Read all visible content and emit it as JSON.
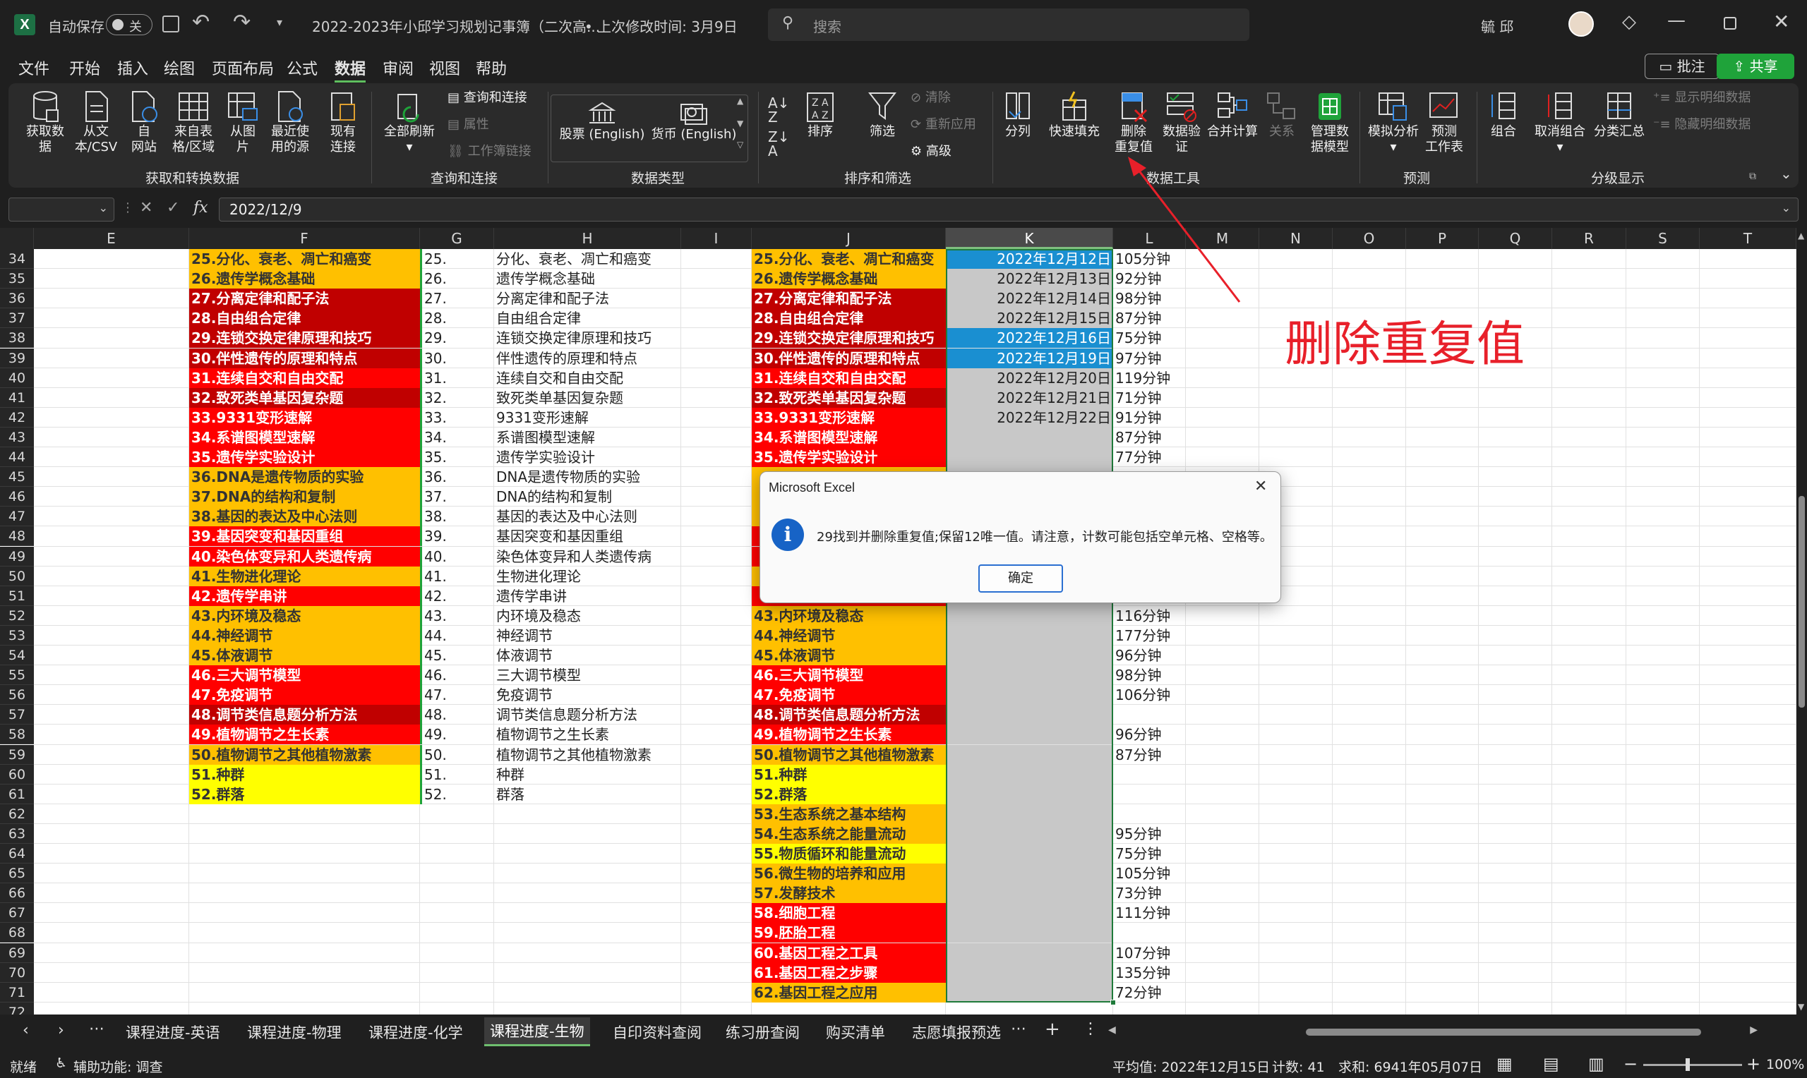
{
  "colors": {
    "red": "#ff0000",
    "darkred": "#c00000",
    "orange": "#ffc000",
    "yellow": "#ffff00",
    "selection": "#c8c8c8",
    "selectedCell": "#1a8fd1",
    "accent": "#1fa33a",
    "annotation": "#e8202a"
  },
  "titlebar": {
    "autosave_label": "自动保存",
    "autosave_state": "关",
    "filename": "2022-2023年小邱学习规划记事簿（二次高...",
    "last_modified": "• 上次修改时间: 3月9日",
    "search_placeholder": "搜索",
    "user": "毓 邱"
  },
  "menu": {
    "items": [
      "文件",
      "开始",
      "插入",
      "绘图",
      "页面布局",
      "公式",
      "数据",
      "审阅",
      "视图",
      "帮助"
    ],
    "comment_button": "批注",
    "share_button": "共享"
  },
  "ribbon": {
    "get_data": "获取数\n据",
    "from_csv": "从文\n本/CSV",
    "from_web": "自\n网站",
    "from_table": "来自表\n格/区域",
    "from_picture": "从图\n片",
    "recent_sources": "最近使\n用的源",
    "existing": "现有\n连接",
    "group_get": "获取和转换数据",
    "refresh_all": "全部刷新",
    "queries": "查询和连接",
    "properties": "属性",
    "workbook_links": "工作簿链接",
    "group_queries": "查询和连接",
    "stocks": "股票 (English)",
    "currency": "货币 (English)",
    "group_datatypes": "数据类型",
    "sort": "排序",
    "filter": "筛选",
    "clear": "清除",
    "reapply": "重新应用",
    "advanced": "高级",
    "group_sort": "排序和筛选",
    "text_to_col": "分列",
    "flash_fill": "快速填充",
    "remove_dup": "删除\n重复值",
    "validation": "数据验\n证",
    "consolidate": "合并计算",
    "relations": "关系",
    "manage_model": "管理数\n据模型",
    "group_tools": "数据工具",
    "whatif": "模拟分析",
    "forecast": "预测\n工作表",
    "group_forecast": "预测",
    "group": "组合",
    "ungroup": "取消组合",
    "subtotal": "分类汇总",
    "show_detail": "显示明细数据",
    "hide_detail": "隐藏明细数据",
    "group_outline": "分级显示"
  },
  "formula": {
    "namebox": "",
    "fx": "fx",
    "value": "2022/12/9"
  },
  "columns": [
    "E",
    "F",
    "G",
    "H",
    "I",
    "J",
    "K",
    "L",
    "M",
    "N",
    "O",
    "P",
    "Q",
    "R",
    "S",
    "T"
  ],
  "rows": [
    {
      "n": "34",
      "F": "25.分化、衰老、凋亡和癌变",
      "Fc": "orange",
      "G": "25.",
      "H": "分化、衰老、凋亡和癌变",
      "J": "25.分化、衰老、凋亡和癌变",
      "Jc": "orange",
      "K": "2022年12月12日",
      "Ksel": true,
      "L": "105分钟"
    },
    {
      "n": "35",
      "F": "26.遗传学概念基础",
      "Fc": "orange",
      "G": "26.",
      "H": "遗传学概念基础",
      "J": "26.遗传学概念基础",
      "Jc": "orange",
      "K": "2022年12月13日",
      "L": "92分钟"
    },
    {
      "n": "36",
      "F": "27.分离定律和配子法",
      "Fc": "darkred",
      "G": "27.",
      "H": "分离定律和配子法",
      "J": "27.分离定律和配子法",
      "Jc": "darkred",
      "K": "2022年12月14日",
      "L": "98分钟"
    },
    {
      "n": "37",
      "F": "28.自由组合定律",
      "Fc": "darkred",
      "G": "28.",
      "H": "自由组合定律",
      "J": "28.自由组合定律",
      "Jc": "darkred",
      "K": "2022年12月15日",
      "L": "87分钟"
    },
    {
      "n": "38",
      "F": "29.连锁交换定律原理和技巧",
      "Fc": "darkred",
      "G": "29.",
      "H": "连锁交换定律原理和技巧",
      "J": "29.连锁交换定律原理和技巧",
      "Jc": "darkred",
      "K": "2022年12月16日",
      "Ksel": true,
      "L": "75分钟"
    },
    {
      "n": "39",
      "F": "30.伴性遗传的原理和特点",
      "Fc": "darkred",
      "G": "30.",
      "H": "伴性遗传的原理和特点",
      "J": "30.伴性遗传的原理和特点",
      "Jc": "darkred",
      "K": "2022年12月19日",
      "Ksel": true,
      "L": "97分钟"
    },
    {
      "n": "40",
      "F": "31.连续自交和自由交配",
      "Fc": "red",
      "G": "31.",
      "H": "连续自交和自由交配",
      "J": "31.连续自交和自由交配",
      "Jc": "red",
      "K": "2022年12月20日",
      "L": "119分钟"
    },
    {
      "n": "41",
      "F": "32.致死类单基因复杂题",
      "Fc": "darkred",
      "G": "32.",
      "H": "致死类单基因复杂题",
      "J": "32.致死类单基因复杂题",
      "Jc": "darkred",
      "K": "2022年12月21日",
      "L": "71分钟"
    },
    {
      "n": "42",
      "F": "33.9331变形速解",
      "Fc": "red",
      "G": "33.",
      "H": "9331变形速解",
      "J": "33.9331变形速解",
      "Jc": "red",
      "K": "2022年12月22日",
      "L": "91分钟"
    },
    {
      "n": "43",
      "F": "34.系谱图模型速解",
      "Fc": "red",
      "G": "34.",
      "H": "系谱图模型速解",
      "J": "34.系谱图模型速解",
      "Jc": "red",
      "K": "",
      "L": "87分钟"
    },
    {
      "n": "44",
      "F": "35.遗传学实验设计",
      "Fc": "red",
      "G": "35.",
      "H": "遗传学实验设计",
      "J": "35.遗传学实验设计",
      "Jc": "red",
      "K": "",
      "L": "77分钟"
    },
    {
      "n": "45",
      "F": "36.DNA是遗传物质的实验",
      "Fc": "orange",
      "G": "36.",
      "H": "DNA是遗传物质的实验",
      "J": "",
      "Jc": "orange",
      "K": "",
      "L": ""
    },
    {
      "n": "46",
      "F": "37.DNA的结构和复制",
      "Fc": "orange",
      "G": "37.",
      "H": "DNA的结构和复制",
      "J": "",
      "Jc": "orange",
      "K": "",
      "L": ""
    },
    {
      "n": "47",
      "F": "38.基因的表达及中心法则",
      "Fc": "orange",
      "G": "38.",
      "H": "基因的表达及中心法则",
      "J": "",
      "Jc": "orange",
      "K": "",
      "L": ""
    },
    {
      "n": "48",
      "F": "39.基因突变和基因重组",
      "Fc": "red",
      "G": "39.",
      "H": "基因突变和基因重组",
      "J": "",
      "Jc": "red",
      "K": "",
      "L": ""
    },
    {
      "n": "49",
      "F": "40.染色体变异和人类遗传病",
      "Fc": "red",
      "G": "40.",
      "H": "染色体变异和人类遗传病",
      "J": "",
      "Jc": "red",
      "K": "",
      "L": ""
    },
    {
      "n": "50",
      "F": "41.生物进化理论",
      "Fc": "orange",
      "G": "41.",
      "H": "生物进化理论",
      "J": "",
      "Jc": "orange",
      "K": "",
      "L": ""
    },
    {
      "n": "51",
      "F": "42.遗传学串讲",
      "Fc": "red",
      "G": "42.",
      "H": "遗传学串讲",
      "J": "",
      "Jc": "red",
      "K": "",
      "L": ""
    },
    {
      "n": "52",
      "F": "43.内环境及稳态",
      "Fc": "orange",
      "G": "43.",
      "H": "内环境及稳态",
      "J": "43.内环境及稳态",
      "Jc": "orange",
      "K": "",
      "L": "116分钟"
    },
    {
      "n": "53",
      "F": "44.神经调节",
      "Fc": "orange",
      "G": "44.",
      "H": "神经调节",
      "J": "44.神经调节",
      "Jc": "orange",
      "K": "",
      "L": "177分钟"
    },
    {
      "n": "54",
      "F": "45.体液调节",
      "Fc": "orange",
      "G": "45.",
      "H": "体液调节",
      "J": "45.体液调节",
      "Jc": "orange",
      "K": "",
      "L": "96分钟"
    },
    {
      "n": "55",
      "F": "46.三大调节模型",
      "Fc": "red",
      "G": "46.",
      "H": "三大调节模型",
      "J": "46.三大调节模型",
      "Jc": "red",
      "K": "",
      "L": "98分钟"
    },
    {
      "n": "56",
      "F": "47.免疫调节",
      "Fc": "red",
      "G": "47.",
      "H": "免疫调节",
      "J": "47.免疫调节",
      "Jc": "red",
      "K": "",
      "L": "106分钟"
    },
    {
      "n": "57",
      "F": "48.调节类信息题分析方法",
      "Fc": "darkred",
      "G": "48.",
      "H": "调节类信息题分析方法",
      "J": "48.调节类信息题分析方法",
      "Jc": "darkred",
      "K": "",
      "L": ""
    },
    {
      "n": "58",
      "F": "49.植物调节之生长素",
      "Fc": "red",
      "G": "49.",
      "H": "植物调节之生长素",
      "J": "49.植物调节之生长素",
      "Jc": "red",
      "K": "",
      "L": "96分钟"
    },
    {
      "n": "59",
      "F": "50.植物调节之其他植物激素",
      "Fc": "orange",
      "G": "50.",
      "H": "植物调节之其他植物激素",
      "J": "50.植物调节之其他植物激素",
      "Jc": "orange",
      "K": "",
      "L": "87分钟"
    },
    {
      "n": "60",
      "F": "51.种群",
      "Fc": "yellow",
      "G": "51.",
      "H": "种群",
      "J": "51.种群",
      "Jc": "yellow",
      "K": "",
      "L": ""
    },
    {
      "n": "61",
      "F": "52.群落",
      "Fc": "yellow",
      "G": "52.",
      "H": "群落",
      "J": "52.群落",
      "Jc": "yellow",
      "K": "",
      "L": ""
    },
    {
      "n": "62",
      "F": "",
      "Fc": "",
      "G": "",
      "H": "",
      "J": "53.生态系统之基本结构",
      "Jc": "orange",
      "K": "",
      "L": ""
    },
    {
      "n": "63",
      "F": "",
      "Fc": "",
      "G": "",
      "H": "",
      "J": "54.生态系统之能量流动",
      "Jc": "orange",
      "K": "",
      "L": "95分钟"
    },
    {
      "n": "64",
      "F": "",
      "Fc": "",
      "G": "",
      "H": "",
      "J": "55.物质循环和能量流动",
      "Jc": "yellow",
      "K": "",
      "L": "75分钟"
    },
    {
      "n": "65",
      "F": "",
      "Fc": "",
      "G": "",
      "H": "",
      "J": "56.微生物的培养和应用",
      "Jc": "orange",
      "K": "",
      "L": "105分钟"
    },
    {
      "n": "66",
      "F": "",
      "Fc": "",
      "G": "",
      "H": "",
      "J": "57.发酵技术",
      "Jc": "orange",
      "K": "",
      "L": "73分钟"
    },
    {
      "n": "67",
      "F": "",
      "Fc": "",
      "G": "",
      "H": "",
      "J": "58.细胞工程",
      "Jc": "red",
      "K": "",
      "L": "111分钟"
    },
    {
      "n": "68",
      "F": "",
      "Fc": "",
      "G": "",
      "H": "",
      "J": "59.胚胎工程",
      "Jc": "red",
      "K": "",
      "L": ""
    },
    {
      "n": "69",
      "F": "",
      "Fc": "",
      "G": "",
      "H": "",
      "J": "60.基因工程之工具",
      "Jc": "red",
      "K": "",
      "L": "107分钟"
    },
    {
      "n": "70",
      "F": "",
      "Fc": "",
      "G": "",
      "H": "",
      "J": "61.基因工程之步骤",
      "Jc": "red",
      "K": "",
      "L": "135分钟"
    },
    {
      "n": "71",
      "F": "",
      "Fc": "",
      "G": "",
      "H": "",
      "J": "62.基因工程之应用",
      "Jc": "orange",
      "K": "",
      "L": "72分钟"
    },
    {
      "n": "72",
      "F": "",
      "Fc": "",
      "G": "",
      "H": "",
      "J": "",
      "Jc": "",
      "K": "",
      "L": ""
    }
  ],
  "dialog": {
    "title": "Microsoft Excel",
    "message": "29找到并删除重复值;保留12唯一值。请注意，计数可能包括空单元格、空格等。",
    "ok": "确定",
    "close": "✕"
  },
  "annotation": "删除重复值",
  "tabs": [
    "课程进度-英语",
    "课程进度-物理",
    "课程进度-化学",
    "课程进度-生物",
    "自印资料查阅",
    "练习册查阅",
    "购买清单",
    "志愿填报预选"
  ],
  "active_tab": "课程进度-生物",
  "status": {
    "ready": "就绪",
    "accessibility": "辅助功能: 调查",
    "average": "平均值: 2022年12月15日",
    "count": "计数: 41",
    "sum": "求和: 6941年05月07日",
    "zoom": "100%"
  }
}
